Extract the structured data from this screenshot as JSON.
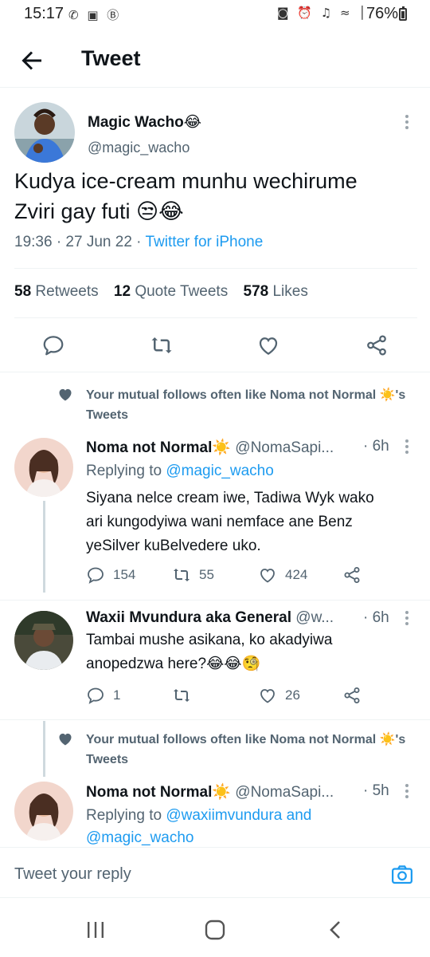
{
  "status_bar": {
    "time": "15:17",
    "left_icons": "✆ ▣ Ⓑ",
    "right_icons": "◙ ⏰ ♫ ≈ │",
    "battery": "76%"
  },
  "header": {
    "title": "Tweet"
  },
  "main_tweet": {
    "name": "Magic Wacho😂",
    "handle": "@magic_wacho",
    "text_line1": "Kudya ice-cream munhu wechirume",
    "text_line2": "Zviri gay futi 😒😂",
    "time": "19:36 · 27 Jun 22 · ",
    "source": "Twitter for iPhone",
    "retweets_count": "58",
    "retweets_label": "Retweets",
    "quotes_count": "12",
    "quotes_label": "Quote Tweets",
    "likes_count": "578",
    "likes_label": "Likes"
  },
  "social_context_1": "Your mutual follows often like Noma not Normal ☀️'s Tweets",
  "reply1": {
    "name": "Noma not Normal☀️",
    "handle": "@NomaSapi...",
    "time": "· 6h",
    "replying_prefix": "Replying to ",
    "replying_to": "@magic_wacho",
    "text_line1": "Siyana nelce cream iwe, Tadiwa Wyk wako",
    "text_line2": "ari kungodyiwa wani nemface ane Benz",
    "text_line3": "yeSilver kuBelvedere uko.",
    "replies": "154",
    "retweets": "55",
    "likes": "424"
  },
  "reply2": {
    "name": "Waxii Mvundura aka General",
    "handle": "@w...",
    "time": "· 6h",
    "text_line1": "Tambai mushe asikana, ko akadyiwa",
    "text_line2": "anopedzwa here?😂😂🧐",
    "replies": "1",
    "retweets": "",
    "likes": "26"
  },
  "social_context_2": "Your mutual follows often like Noma not Normal ☀️'s Tweets",
  "reply3": {
    "name": "Noma not Normal☀️",
    "handle": "@NomaSapi...",
    "time": "· 5h",
    "replying_prefix": "Replying to ",
    "replying_to": "@waxiimvundura and",
    "replying_to2": "@magic_wacho"
  },
  "composer": {
    "placeholder": "Tweet your reply"
  },
  "colors": {
    "accent": "#1d9bf0",
    "secondary_text": "#536471",
    "primary_text": "#0f1419",
    "border": "#eff3f4"
  }
}
